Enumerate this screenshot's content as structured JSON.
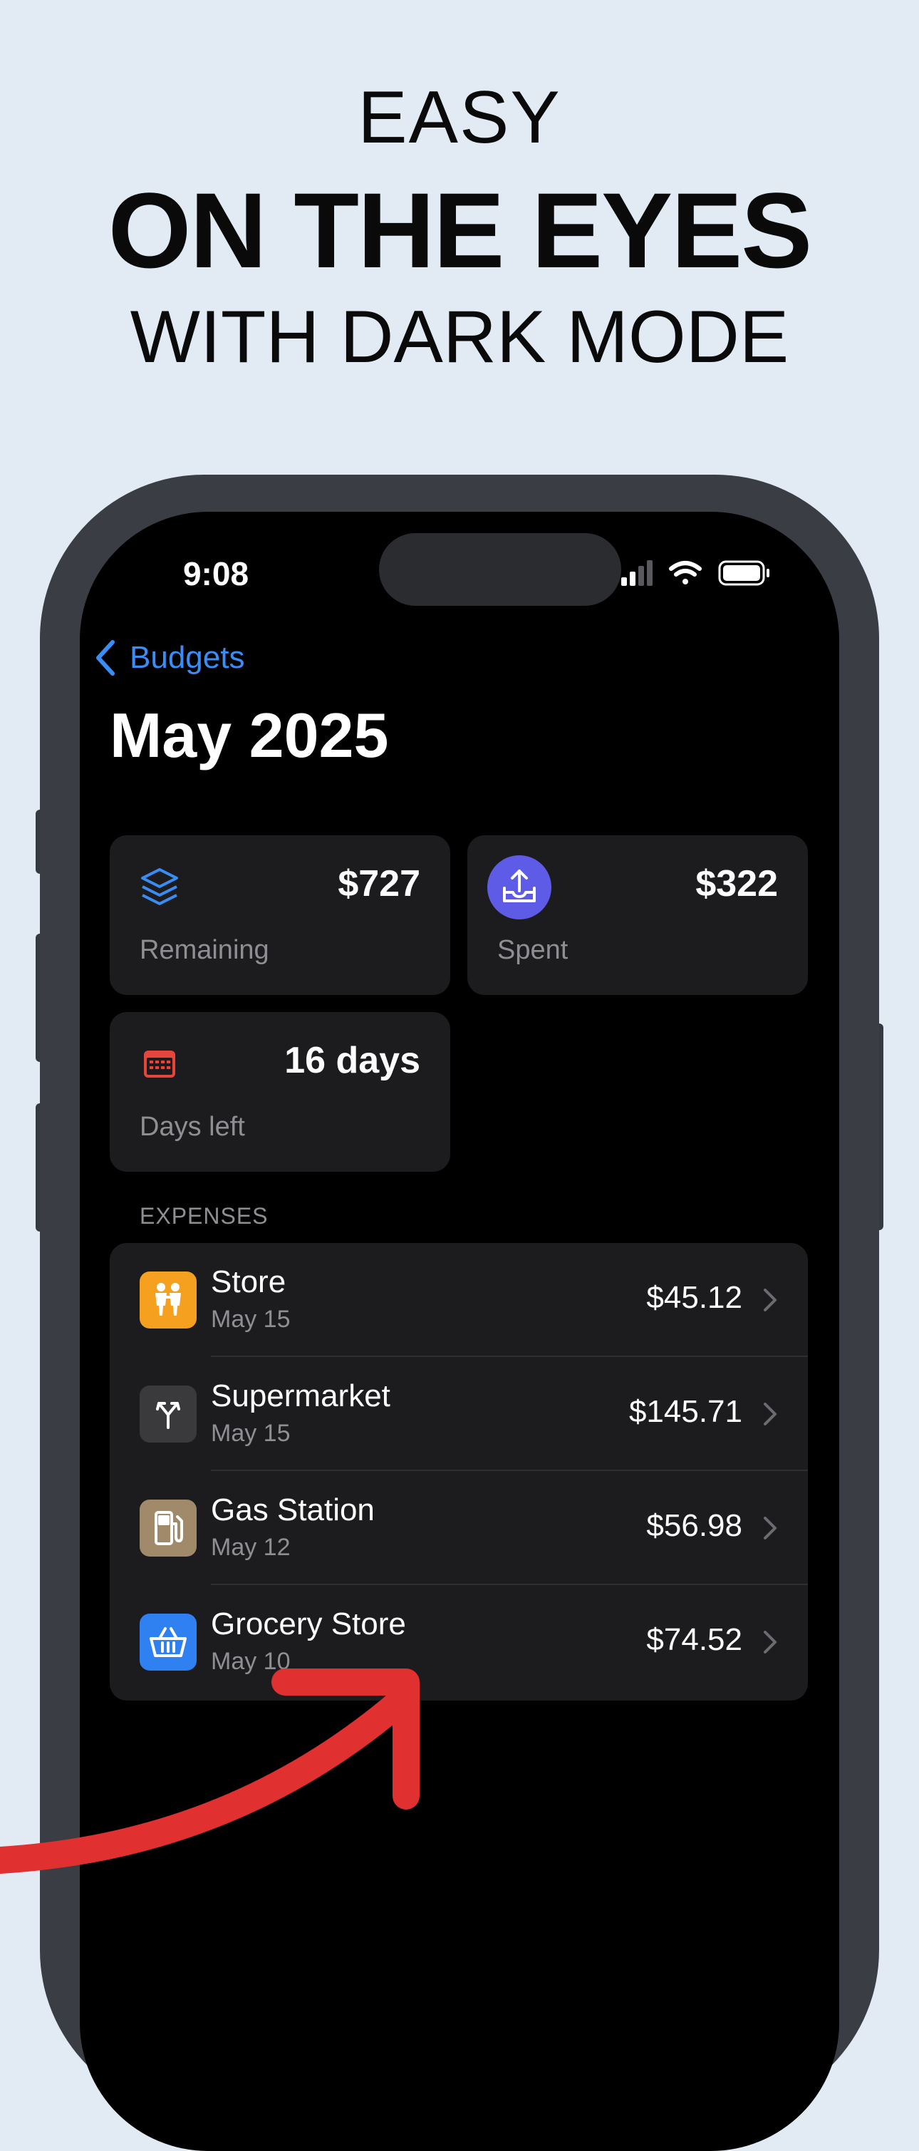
{
  "headline": {
    "line1": "EASY",
    "line2": "ON THE EYES",
    "line3": "WITH DARK MODE"
  },
  "status_bar": {
    "time": "9:08",
    "icons": [
      "cellular-signal-icon",
      "wifi-icon",
      "battery-icon"
    ]
  },
  "nav": {
    "back_label": "Budgets",
    "title": "May 2025"
  },
  "summary": {
    "remaining": {
      "value": "$727",
      "label": "Remaining",
      "icon": "stack-layers-icon",
      "color": "#3a8df5"
    },
    "spent": {
      "value": "$322",
      "label": "Spent",
      "icon": "tray-upload-icon",
      "color": "#5e5ce6"
    },
    "days_left": {
      "value": "16 days",
      "label": "Days left",
      "icon": "calendar-icon",
      "color": "#e5453b"
    }
  },
  "expenses": {
    "section_label": "EXPENSES",
    "items": [
      {
        "name": "Store",
        "date": "May 15",
        "amount": "$45.12",
        "icon": "people-icon",
        "color": "#f5a01f"
      },
      {
        "name": "Supermarket",
        "date": "May 15",
        "amount": "$145.71",
        "icon": "fork-split-icon",
        "color": "#3a3a3c"
      },
      {
        "name": "Gas Station",
        "date": "May 12",
        "amount": "$56.98",
        "icon": "fuel-pump-icon",
        "color": "#a08a6a"
      },
      {
        "name": "Grocery Store",
        "date": "May 10",
        "amount": "$74.52",
        "icon": "basket-icon",
        "color": "#2f80f0"
      }
    ]
  },
  "colors": {
    "background": "#e2ebf4",
    "accent": "#3a8df5",
    "annotation_arrow": "#e03030"
  }
}
